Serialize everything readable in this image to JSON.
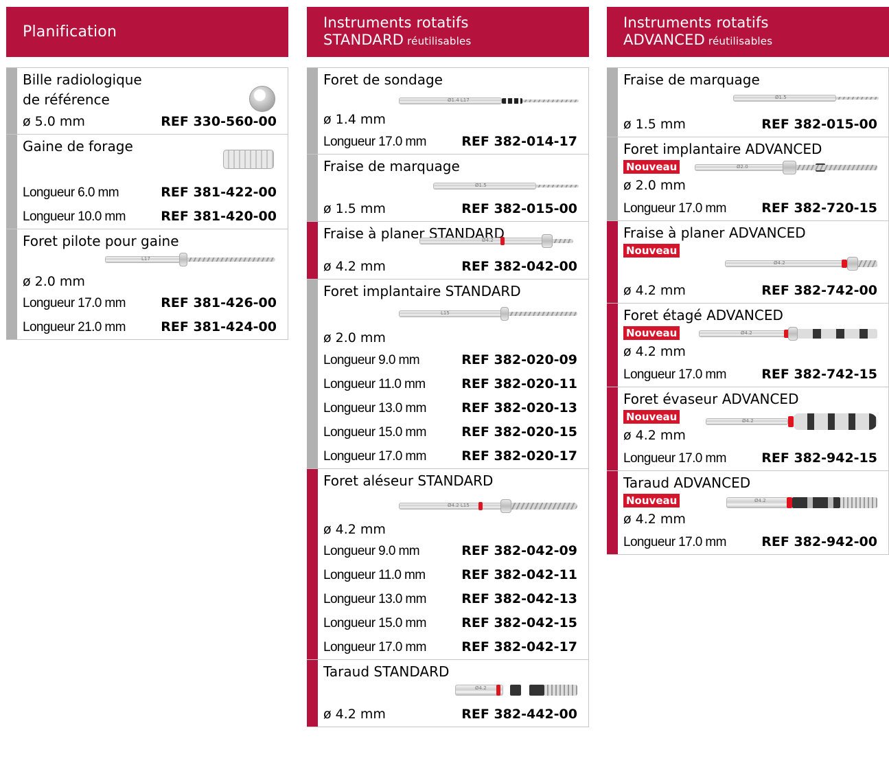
{
  "accent_color": "#b5123e",
  "badge_color": "#d5152c",
  "columns": [
    {
      "header": {
        "line1": "Planification"
      },
      "items": [
        {
          "title": [
            "Bille radiologique",
            "de référence"
          ],
          "rows": [
            {
              "spec": "ø 5.0 mm",
              "ref": "REF 330-560-00"
            }
          ]
        },
        {
          "title": [
            "Gaine de forage"
          ],
          "rows": [
            {
              "spec": "Longueur 6.0 mm",
              "ref": "REF 381-422-00"
            },
            {
              "spec": "Longueur 10.0 mm",
              "ref": "REF 381-420-00"
            }
          ]
        },
        {
          "title": [
            "Foret pilote pour gaine"
          ],
          "diameter": "ø 2.0 mm",
          "rows": [
            {
              "spec": "Longueur 17.0 mm",
              "ref": "REF 381-426-00"
            },
            {
              "spec": "Longueur 21.0 mm",
              "ref": "REF 381-424-00"
            }
          ],
          "tool_label": "L17"
        }
      ]
    },
    {
      "header": {
        "line1": "Instruments rotatifs",
        "line2_main": "STANDARD",
        "line2_small": " réutilisables"
      },
      "items": [
        {
          "title": [
            "Foret de sondage"
          ],
          "diameter": "ø 1.4 mm",
          "rows": [
            {
              "spec": "Longueur 17.0 mm",
              "ref": "REF 382-014-17"
            }
          ],
          "tool_label": "Ø1.4 L17"
        },
        {
          "title": [
            "Fraise de marquage"
          ],
          "rows": [
            {
              "spec": "ø 1.5 mm",
              "ref": "REF 382-015-00"
            }
          ],
          "tool_label": "Ø1.5"
        },
        {
          "title": [
            "Fraise à planer STANDARD"
          ],
          "rows": [
            {
              "spec": "ø 4.2 mm",
              "ref": "REF 382-042-00"
            }
          ],
          "tool_label": "Ø4.2"
        },
        {
          "title": [
            "Foret implantaire STANDARD"
          ],
          "diameter": "ø 2.0 mm",
          "rows": [
            {
              "spec": "Longueur 9.0 mm",
              "ref": "REF 382-020-09"
            },
            {
              "spec": "Longueur 11.0 mm",
              "ref": "REF 382-020-11"
            },
            {
              "spec": "Longueur 13.0 mm",
              "ref": "REF 382-020-13"
            },
            {
              "spec": "Longueur 15.0 mm",
              "ref": "REF 382-020-15"
            },
            {
              "spec": "Longueur 17.0 mm",
              "ref": "REF 382-020-17"
            }
          ],
          "tool_label": "L15"
        },
        {
          "title": [
            "Foret aléseur STANDARD"
          ],
          "diameter": "ø 4.2 mm",
          "rows": [
            {
              "spec": "Longueur 9.0 mm",
              "ref": "REF 382-042-09"
            },
            {
              "spec": "Longueur 11.0 mm",
              "ref": "REF 382-042-11"
            },
            {
              "spec": "Longueur 13.0 mm",
              "ref": "REF 382-042-13"
            },
            {
              "spec": "Longueur 15.0 mm",
              "ref": "REF 382-042-15"
            },
            {
              "spec": "Longueur 17.0 mm",
              "ref": "REF 382-042-17"
            }
          ],
          "tool_label": "Ø4.2 L15"
        },
        {
          "title": [
            "Taraud STANDARD"
          ],
          "rows": [
            {
              "spec": "ø 4.2 mm",
              "ref": "REF 382-442-00"
            }
          ],
          "tool_label": "Ø4.2"
        }
      ]
    },
    {
      "header": {
        "line1": "Instruments rotatifs",
        "line2_main": "ADVANCED",
        "line2_small": " réutilisables"
      },
      "items": [
        {
          "title": [
            "Fraise de marquage"
          ],
          "rows": [
            {
              "spec": "ø 1.5 mm",
              "ref": "REF 382-015-00"
            }
          ],
          "tool_label": "Ø1.5"
        },
        {
          "title": [
            "Foret implantaire ADVANCED"
          ],
          "badge": "Nouveau",
          "diameter": "ø 2.0 mm",
          "rows": [
            {
              "spec": "Longueur 17.0 mm",
              "ref": "REF 382-720-15"
            }
          ],
          "tool_label": "Ø2.0"
        },
        {
          "title": [
            "Fraise à planer ADVANCED"
          ],
          "badge": "Nouveau",
          "rows": [
            {
              "spec": "ø 4.2 mm",
              "ref": "REF 382-742-00"
            }
          ],
          "tool_label": "Ø4.2"
        },
        {
          "title": [
            "Foret étagé ADVANCED"
          ],
          "badge": "Nouveau",
          "diameter": "ø 4.2 mm",
          "rows": [
            {
              "spec": "Longueur 17.0 mm",
              "ref": "REF 382-742-15"
            }
          ],
          "tool_label": "Ø4.2"
        },
        {
          "title": [
            "Foret évaseur ADVANCED"
          ],
          "badge": "Nouveau",
          "diameter": "ø 4.2 mm",
          "rows": [
            {
              "spec": "Longueur 17.0 mm",
              "ref": "REF 382-942-15"
            }
          ],
          "tool_label": "Ø4.2"
        },
        {
          "title": [
            "Taraud ADVANCED"
          ],
          "badge": "Nouveau",
          "diameter": "ø 4.2 mm",
          "rows": [
            {
              "spec": "Longueur 17.0 mm",
              "ref": "REF 382-942-00"
            }
          ],
          "tool_label": "Ø4.2"
        }
      ]
    }
  ]
}
